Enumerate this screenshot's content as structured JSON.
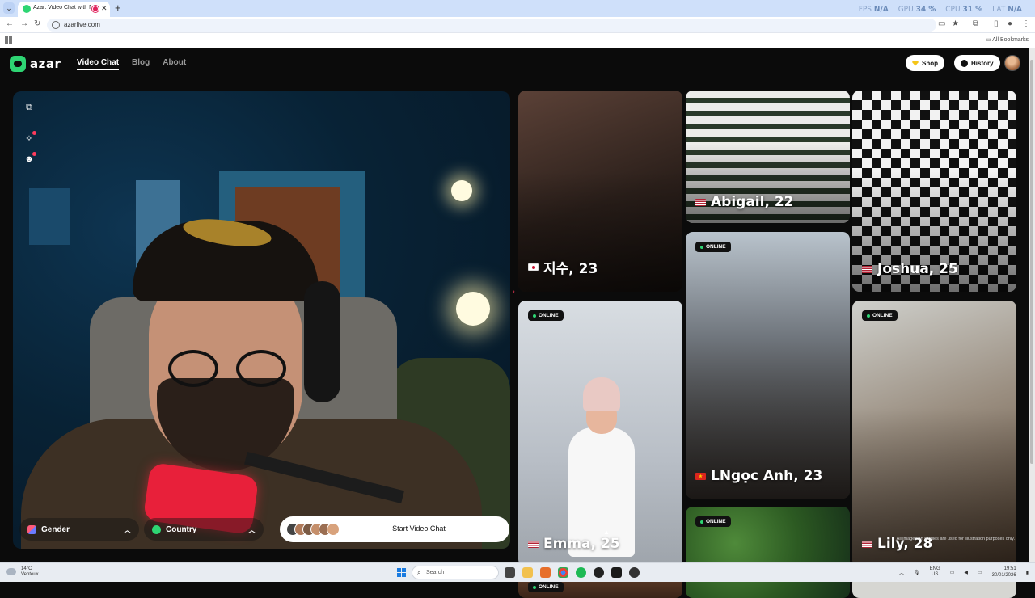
{
  "browser": {
    "tab_title": "Azar: Video Chat with New",
    "url": "azarlive.com",
    "all_bookmarks": "All Bookmarks",
    "perf": [
      {
        "label": "FPS",
        "value": "N/A"
      },
      {
        "label": "GPU",
        "value": "34 %"
      },
      {
        "label": "CPU",
        "value": "31 %"
      },
      {
        "label": "LAT",
        "value": "N/A"
      }
    ]
  },
  "header": {
    "brand": "azar",
    "nav": [
      "Video Chat",
      "Blog",
      "About"
    ],
    "shop": "Shop",
    "history": "History"
  },
  "camera": {
    "gender": "Gender",
    "country": "Country",
    "start": "Start Video Chat"
  },
  "profiles": {
    "jisoo": {
      "name": "지수, 23"
    },
    "abigail": {
      "name": "Abigail, 22"
    },
    "joshua": {
      "name": "Joshua, 25"
    },
    "lngoc": {
      "name": "LNgọc Anh, 23",
      "online": "ONLINE"
    },
    "emma": {
      "name": "Emma, 25",
      "online": "ONLINE"
    },
    "lily": {
      "name": "Lily, 28",
      "online": "ONLINE"
    },
    "plant": {
      "online": "ONLINE"
    },
    "bottom_left": {
      "online": "ONLINE"
    }
  },
  "disclaimer": "All images on profiles are used for illustration purposes only.",
  "taskbar": {
    "temp": "14°C",
    "weather": "Venteux",
    "search": "Search",
    "lang": "ENG",
    "region": "US",
    "time": "19:51",
    "date": "30/01/2026"
  },
  "colors": {
    "accent": "#2ed573",
    "notify": "#ff3b5c"
  }
}
